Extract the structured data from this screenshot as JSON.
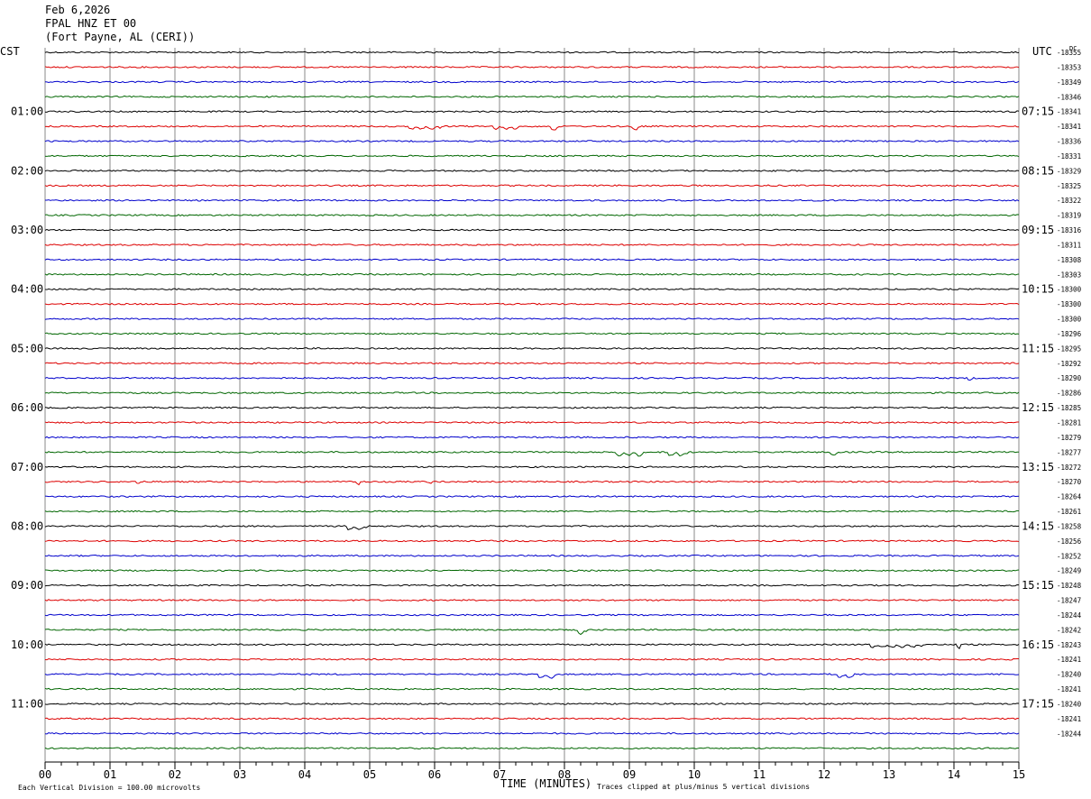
{
  "header": {
    "date": "Feb 6,2026",
    "station": "FPAL HNZ ET 00",
    "location": "(Fort Payne, AL (CERI))"
  },
  "left_tz": "CST",
  "right_tz": "UTC",
  "dc_label": "DC",
  "footer": {
    "scale_note": "Each Vertical Division =  100.00 microvolts",
    "xlabel": "TIME (MINUTES)",
    "clip_note": "Traces clipped at plus/minus 5 vertical divisions"
  },
  "colors": [
    "#000000",
    "#dd0000",
    "#0000cc",
    "#006600"
  ],
  "chart_data": {
    "type": "line",
    "title": "FPAL HNZ ET 00",
    "xlabel": "TIME (MINUTES)",
    "xlim": [
      0,
      15
    ],
    "x_ticks": [
      "00",
      "01",
      "02",
      "03",
      "04",
      "05",
      "06",
      "07",
      "08",
      "09",
      "10",
      "11",
      "12",
      "13",
      "14",
      "15"
    ],
    "rows": 48,
    "minutes_per_row": 15,
    "cst_labels": [
      {
        "row": 4,
        "label": "01:00"
      },
      {
        "row": 8,
        "label": "02:00"
      },
      {
        "row": 12,
        "label": "03:00"
      },
      {
        "row": 16,
        "label": "04:00"
      },
      {
        "row": 20,
        "label": "05:00"
      },
      {
        "row": 24,
        "label": "06:00"
      },
      {
        "row": 28,
        "label": "07:00"
      },
      {
        "row": 32,
        "label": "08:00"
      },
      {
        "row": 36,
        "label": "09:00"
      },
      {
        "row": 40,
        "label": "10:00"
      },
      {
        "row": 44,
        "label": "11:00"
      }
    ],
    "utc_labels": [
      {
        "row": 4,
        "label": "07:15"
      },
      {
        "row": 8,
        "label": "08:15"
      },
      {
        "row": 12,
        "label": "09:15"
      },
      {
        "row": 16,
        "label": "10:15"
      },
      {
        "row": 20,
        "label": "11:15"
      },
      {
        "row": 24,
        "label": "12:15"
      },
      {
        "row": 28,
        "label": "13:15"
      },
      {
        "row": 32,
        "label": "14:15"
      },
      {
        "row": 36,
        "label": "15:15"
      },
      {
        "row": 40,
        "label": "16:15"
      },
      {
        "row": 44,
        "label": "17:15"
      }
    ],
    "dc_offsets": [
      "-18355",
      "-18353",
      "-18349",
      "-18346",
      "-18341",
      "-18341",
      "-18336",
      "-18331",
      "-18329",
      "-18325",
      "-18322",
      "-18319",
      "-18316",
      "-18311",
      "-18308",
      "-18303",
      "-18300",
      "-18300",
      "-18300",
      "-18296",
      "-18295",
      "-18292",
      "-18290",
      "-18286",
      "-18285",
      "-18281",
      "-18279",
      "-18277",
      "-18272",
      "-18270",
      "-18264",
      "-18261",
      "-18258",
      "-18256",
      "-18252",
      "-18249",
      "-18248",
      "-18247",
      "-18244",
      "-18242",
      "-18243",
      "-18241",
      "-18240",
      "-18241",
      "-18240",
      "-18241",
      "-18244"
    ],
    "events": [
      {
        "row": 5,
        "start": 5.6,
        "end": 6.1,
        "depth": 3
      },
      {
        "row": 5,
        "start": 6.9,
        "end": 7.3,
        "depth": 3
      },
      {
        "row": 5,
        "start": 7.8,
        "end": 7.9,
        "depth": 4
      },
      {
        "row": 5,
        "start": 9.05,
        "end": 9.15,
        "depth": 4
      },
      {
        "row": 22,
        "start": 14.2,
        "end": 14.3,
        "depth": 2
      },
      {
        "row": 27,
        "start": 8.8,
        "end": 9.2,
        "depth": 4
      },
      {
        "row": 27,
        "start": 9.6,
        "end": 9.9,
        "depth": 4
      },
      {
        "row": 27,
        "start": 12.1,
        "end": 12.2,
        "depth": 3
      },
      {
        "row": 29,
        "start": 1.4,
        "end": 1.45,
        "depth": 2
      },
      {
        "row": 29,
        "start": 4.8,
        "end": 4.85,
        "depth": 3
      },
      {
        "row": 29,
        "start": 5.9,
        "end": 5.95,
        "depth": 2
      },
      {
        "row": 32,
        "start": 4.65,
        "end": 4.95,
        "depth": 4
      },
      {
        "row": 39,
        "start": 8.2,
        "end": 8.35,
        "depth": 5
      },
      {
        "row": 40,
        "start": 12.7,
        "end": 13.5,
        "depth": 3
      },
      {
        "row": 40,
        "start": 14.05,
        "end": 14.1,
        "depth": 4
      },
      {
        "row": 42,
        "start": 7.6,
        "end": 7.9,
        "depth": 4
      },
      {
        "row": 42,
        "start": 12.2,
        "end": 12.45,
        "depth": 4
      }
    ]
  }
}
